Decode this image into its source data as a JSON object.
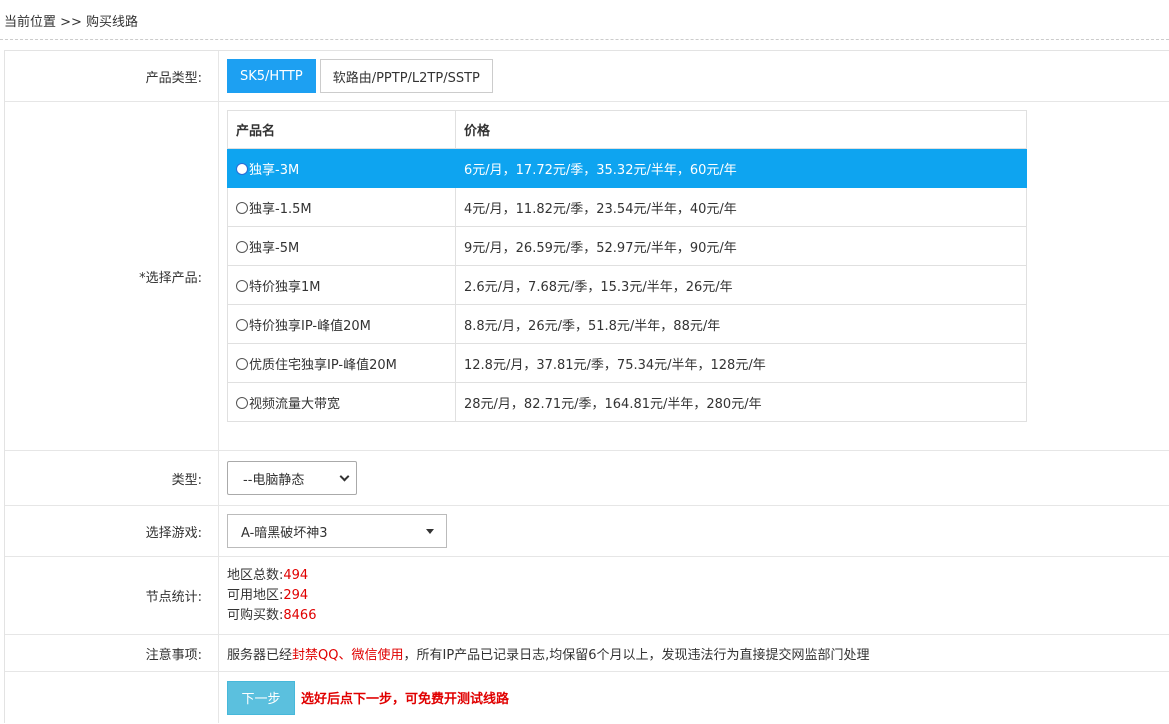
{
  "breadcrumb": "当前位置 >> 购买线路",
  "form": {
    "product_type": {
      "label": "产品类型:",
      "options": [
        "SK5/HTTP",
        "软路由/PPTP/L2TP/SSTP"
      ],
      "selected": "SK5/HTTP"
    },
    "product_select": {
      "label": "*选择产品:",
      "headers": [
        "产品名",
        "价格"
      ],
      "rows": [
        {
          "name": "独享-3M",
          "price": "6元/月，17.72元/季，35.32元/半年，60元/年",
          "selected": true
        },
        {
          "name": "独享-1.5M",
          "price": "4元/月，11.82元/季，23.54元/半年，40元/年",
          "selected": false
        },
        {
          "name": "独享-5M",
          "price": "9元/月，26.59元/季，52.97元/半年，90元/年",
          "selected": false
        },
        {
          "name": "特价独享1M",
          "price": "2.6元/月，7.68元/季，15.3元/半年，26元/年",
          "selected": false
        },
        {
          "name": "特价独享IP-峰值20M",
          "price": "8.8元/月，26元/季，51.8元/半年，88元/年",
          "selected": false
        },
        {
          "name": "优质住宅独享IP-峰值20M",
          "price": "12.8元/月，37.81元/季，75.34元/半年，128元/年",
          "selected": false
        },
        {
          "name": "视频流量大带宽",
          "price": "28元/月，82.71元/季，164.81元/半年，280元/年",
          "selected": false
        }
      ]
    },
    "kind": {
      "label": "类型:",
      "value": "--电脑静态"
    },
    "game": {
      "label": "选择游戏:",
      "value": "A-暗黑破坏神3"
    },
    "stats": {
      "label": "节点统计:",
      "total_label": "地区总数:",
      "total": "494",
      "available_label": "可用地区:",
      "available": "294",
      "buyable_label": "可购买数:",
      "buyable": "8466"
    },
    "notice": {
      "label": "注意事项:",
      "part1": "服务器已经",
      "highlight": "封禁QQ、微信使用",
      "part2": "，所有IP产品已记录日志,均保留6个月以上，发现违法行为直接提交网监部门处理"
    },
    "next": {
      "button": "下一步",
      "hint": "选好后点下一步，可免费开测试线路"
    }
  }
}
